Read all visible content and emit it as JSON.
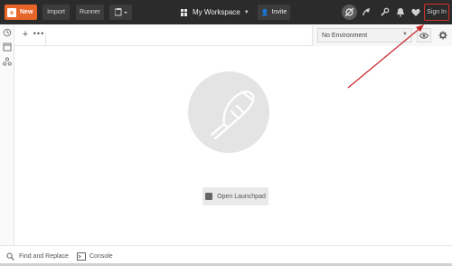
{
  "topbar": {
    "new_label": "New",
    "import_label": "Import",
    "runner_label": "Runner",
    "workspace_label": "My Workspace",
    "invite_label": "Invite",
    "signin_label": "Sign In"
  },
  "tabs": {
    "add_label": "+",
    "more_label": "•••"
  },
  "environment": {
    "selected": "No Environment"
  },
  "main": {
    "launchpad_label": "Open Launchpad"
  },
  "statusbar": {
    "find_replace_label": "Find and Replace",
    "console_label": "Console"
  },
  "colors": {
    "accent": "#e8652a",
    "topbar_bg": "#2b2b2b",
    "annotation": "#d4302c"
  },
  "icons": [
    "history-icon",
    "collections-icon",
    "apis-icon",
    "sync-icon",
    "satellite-icon",
    "settings-wrench-icon",
    "bell-icon",
    "heart-icon",
    "eye-icon",
    "gear-icon",
    "postman-logo-icon",
    "find-icon",
    "console-icon"
  ]
}
